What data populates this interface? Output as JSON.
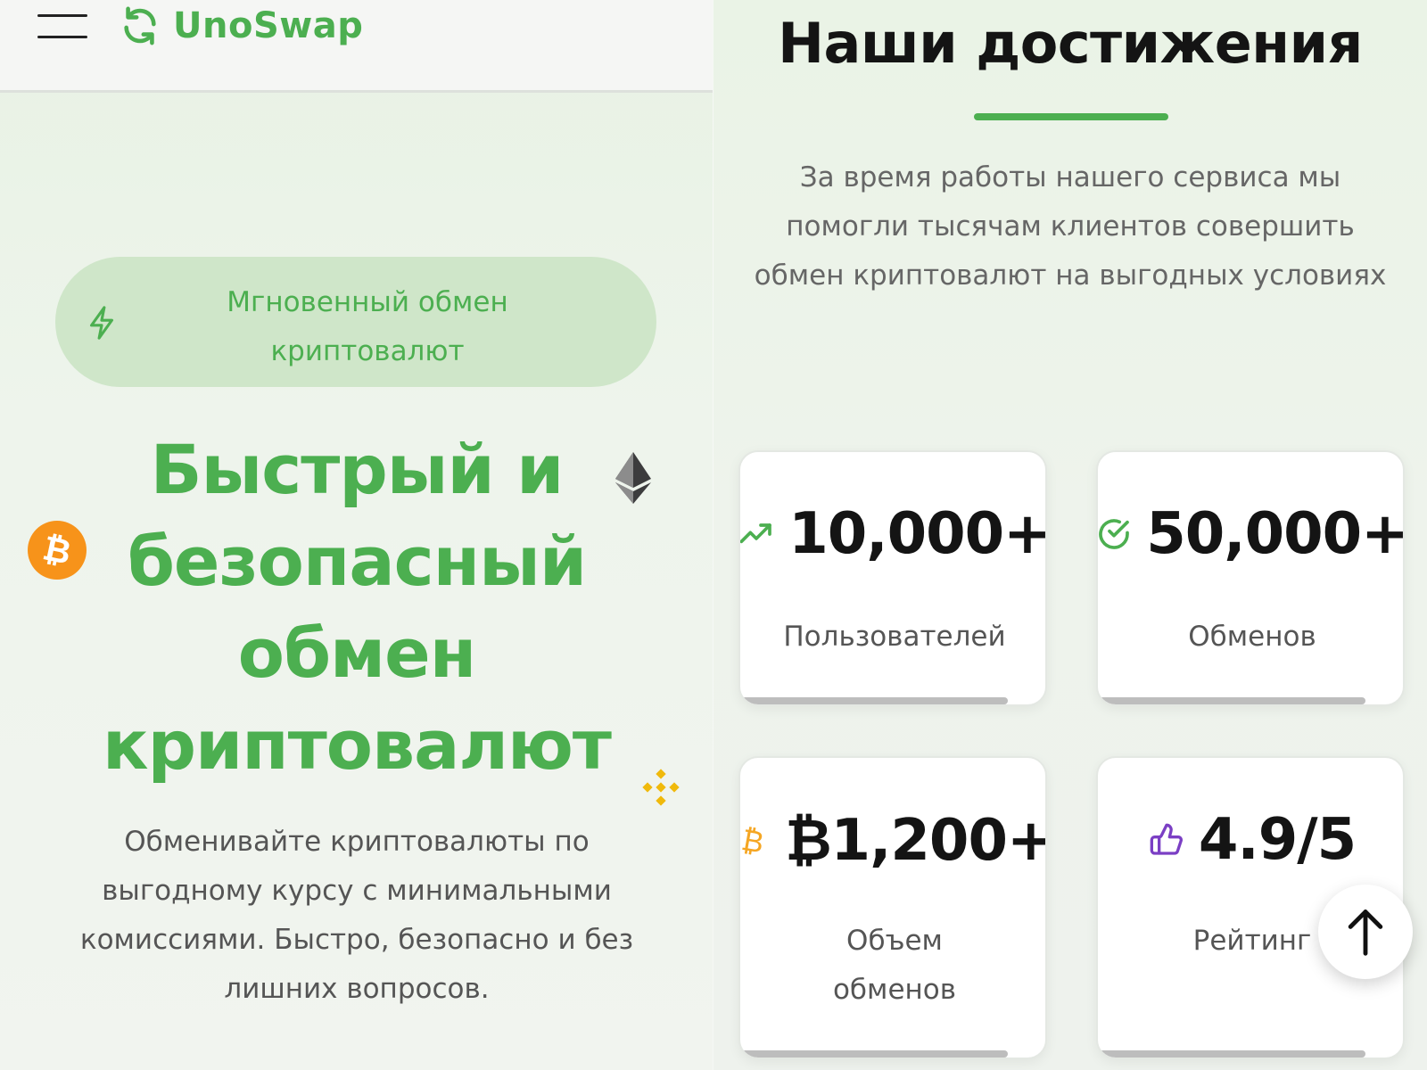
{
  "header": {
    "menu_icon": "hamburger-menu-icon",
    "logo_icon": "refresh-arrows-icon",
    "logo_text": "UnoSwap"
  },
  "hero": {
    "badge_icon": "lightning-icon",
    "badge_text": "Мгновенный обмен криптовалют",
    "title": "Быстрый и безопасный обмен криптовалют",
    "description": "Обменивайте криптовалюты по выгодному курсу с минимальными комиссиями. Быстро, безопасно и без лишних вопросов.",
    "decor_icons": [
      "bitcoin-coin-icon",
      "ethereum-icon",
      "binance-icon"
    ]
  },
  "achievements": {
    "title": "Наши достижения",
    "description": "За время работы нашего сервиса мы помогли тысячам клиентов совершить обмен криптовалют на выгодных условиях",
    "cards": [
      {
        "icon": "trending-up-icon",
        "value": "10,000+",
        "label": "Пользователей",
        "icon_color": "#4caf50"
      },
      {
        "icon": "check-circle-icon",
        "value": "50,000+",
        "label": "Обменов",
        "icon_color": "#4caf50"
      },
      {
        "icon": "bitcoin-icon",
        "value": "₿1,200+",
        "label": "Объем обменов",
        "icon_color": "#f5a623"
      },
      {
        "icon": "thumbs-up-icon",
        "value": "4.9/5",
        "label": "Рейтинг",
        "icon_color": "#7b3fc4"
      }
    ]
  },
  "scroll_top": {
    "icon": "arrow-up-icon"
  },
  "colors": {
    "brand_green": "#4caf50",
    "badge_bg": "#cfe6c9",
    "bitcoin_orange": "#f7931a",
    "binance_yellow": "#f0b90b"
  }
}
